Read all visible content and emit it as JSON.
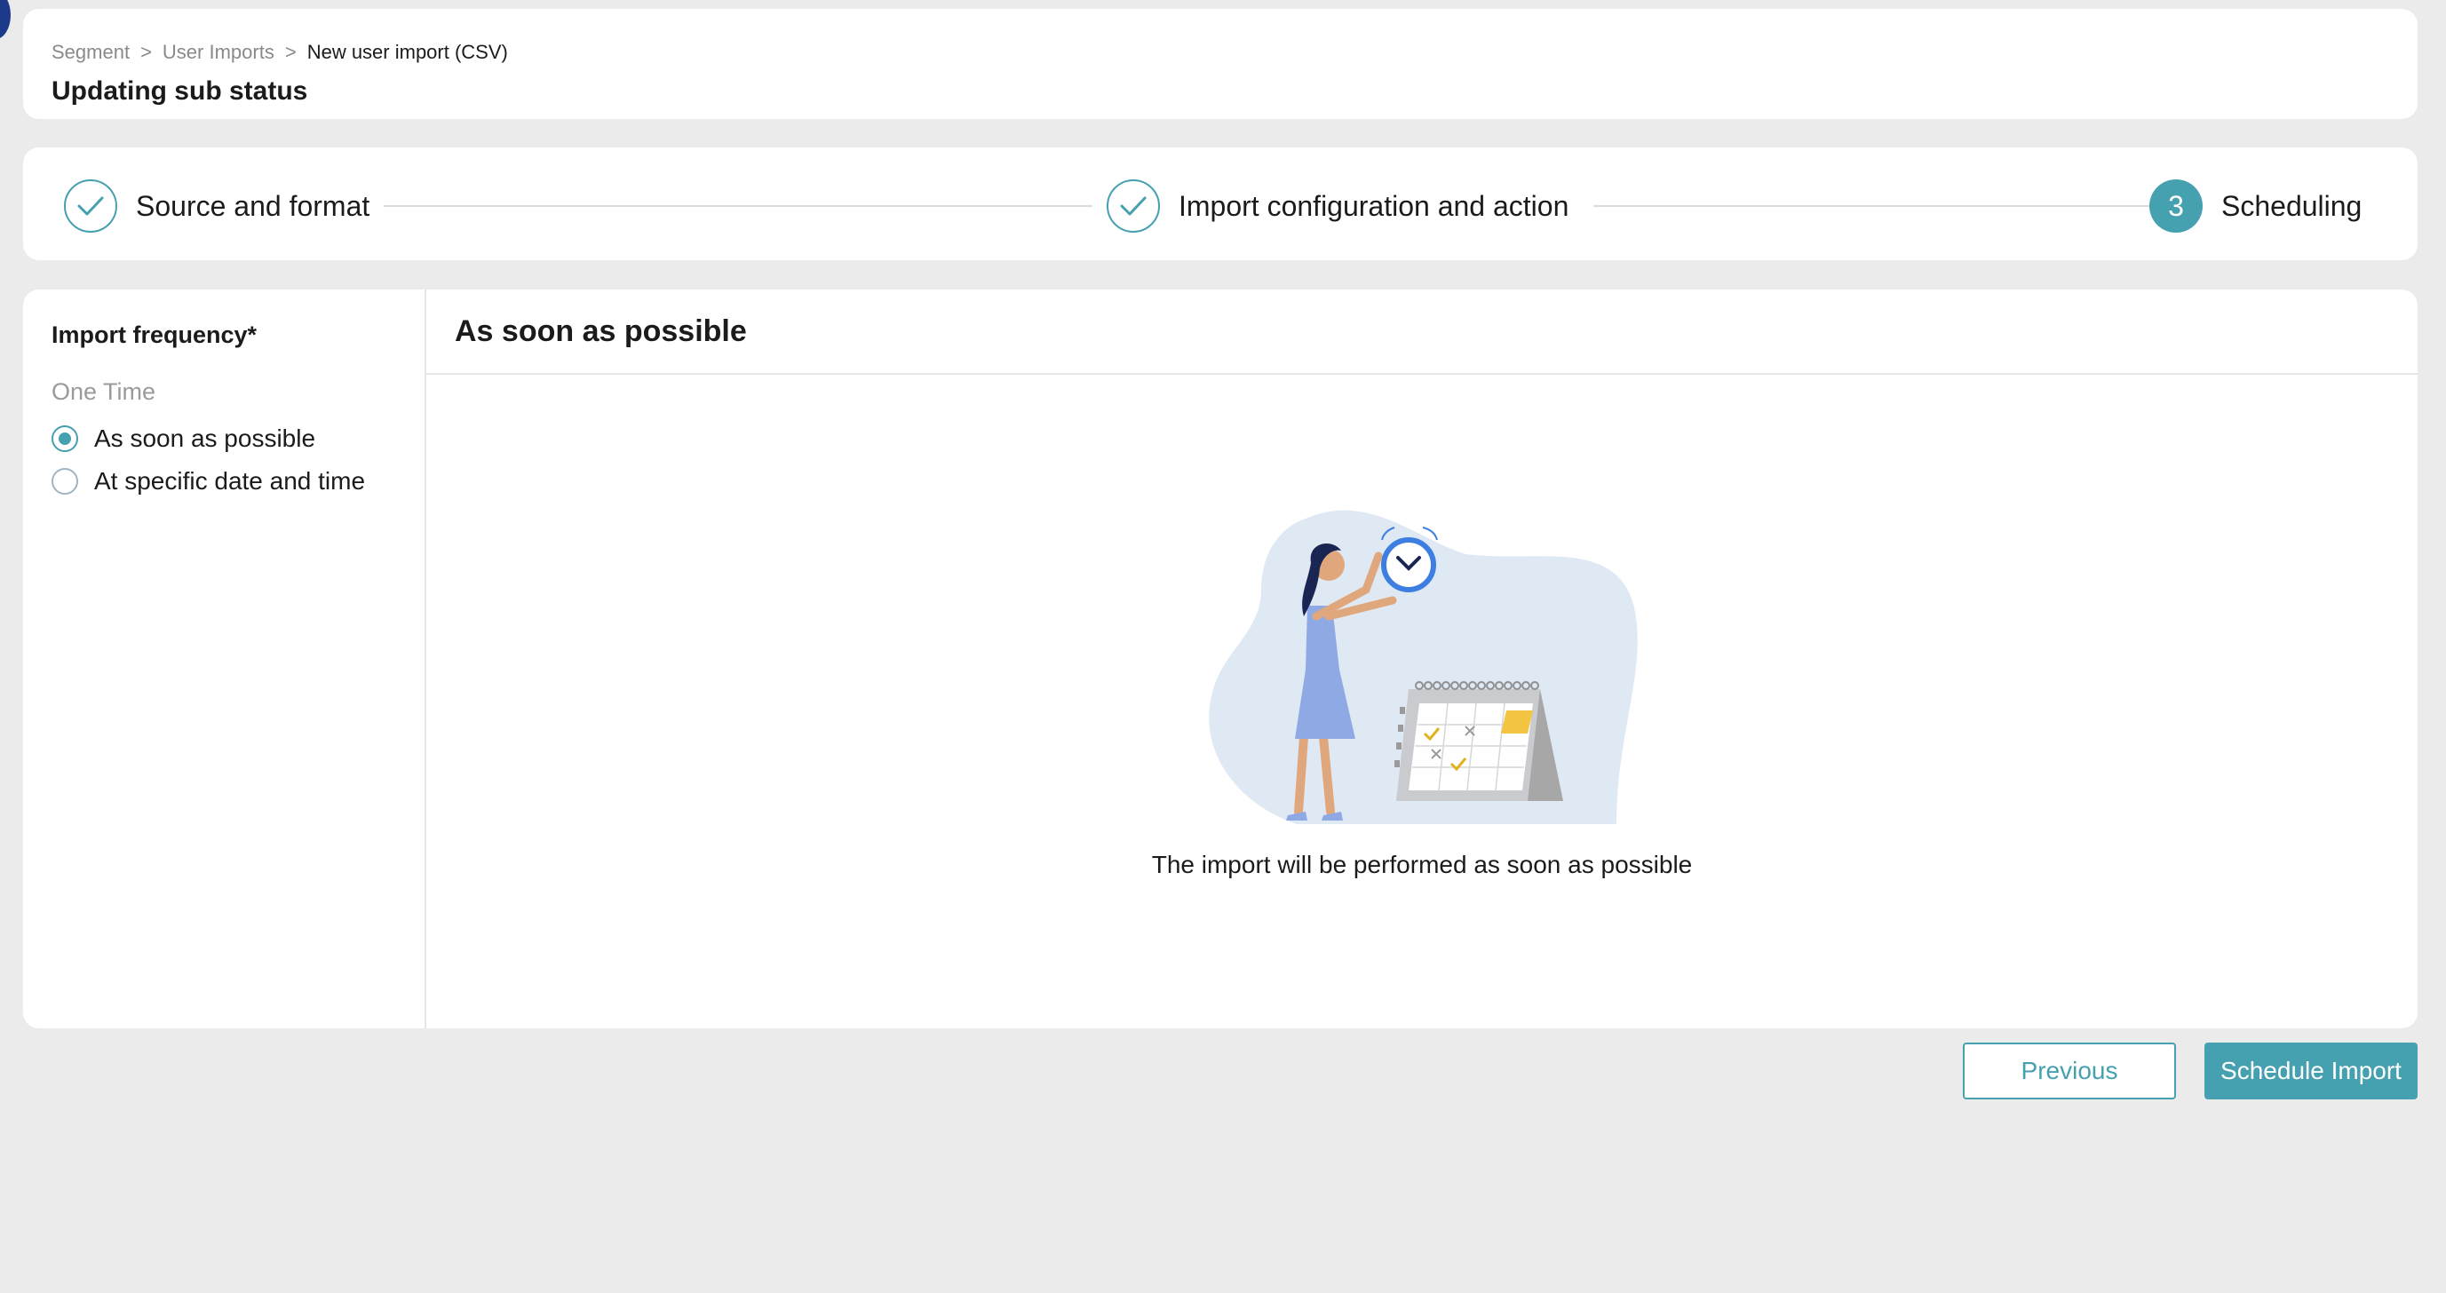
{
  "breadcrumb": {
    "items": [
      "Segment",
      "User Imports",
      "New user import (CSV)"
    ],
    "separator": ">"
  },
  "page": {
    "title": "Updating sub status"
  },
  "steps": [
    {
      "label": "Source and format",
      "status": "completed",
      "icon": "check-icon"
    },
    {
      "label": "Import configuration and action",
      "status": "completed",
      "icon": "check-icon"
    },
    {
      "label": "Scheduling",
      "status": "active",
      "number": "3"
    }
  ],
  "import_frequency": {
    "label": "Import frequency*",
    "group_label": "One Time",
    "options": [
      {
        "label": "As soon as possible",
        "selected": true
      },
      {
        "label": "At specific date and time",
        "selected": false
      }
    ]
  },
  "detail": {
    "title": "As soon as possible",
    "illustration": "woman-with-clock-and-calendar-illustration",
    "caption": "The import will be performed as soon as possible"
  },
  "actions": {
    "previous_label": "Previous",
    "schedule_label": "Schedule Import"
  },
  "colors": {
    "accent": "#45a0b0",
    "background": "#ebebeb",
    "card": "#ffffff"
  }
}
